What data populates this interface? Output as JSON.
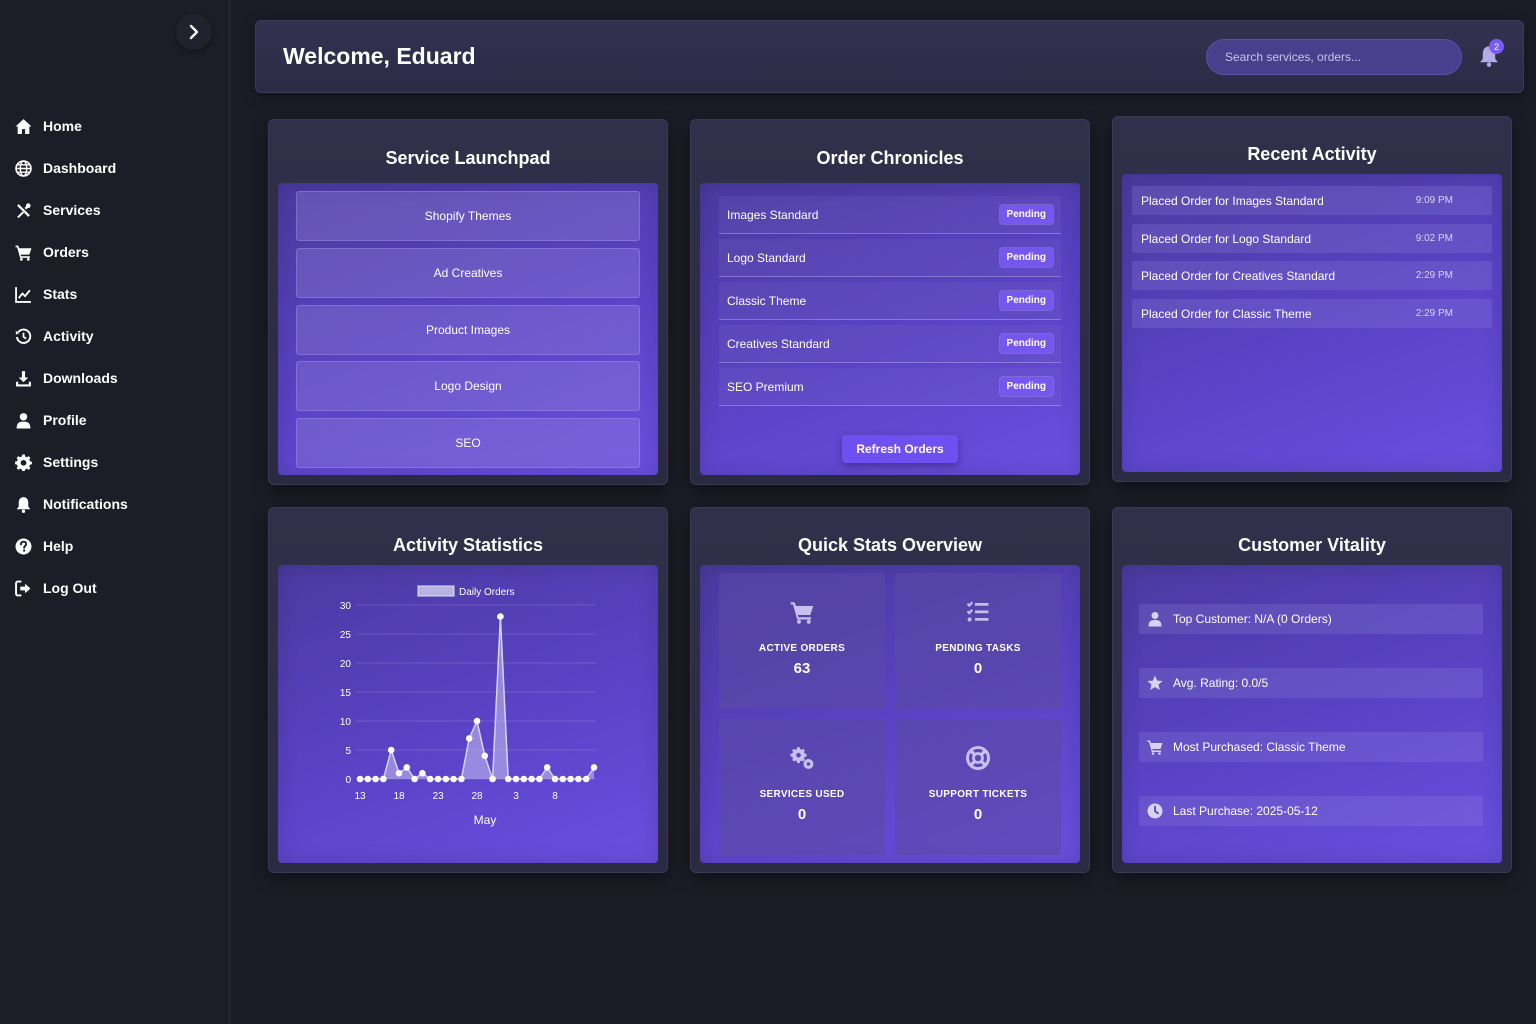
{
  "header": {
    "title": "Welcome, Eduard",
    "search_placeholder": "Search services, orders...",
    "notification_count": "2"
  },
  "sidebar": {
    "items": [
      {
        "label": "Home",
        "icon": "home-icon"
      },
      {
        "label": "Dashboard",
        "icon": "globe-icon"
      },
      {
        "label": "Services",
        "icon": "tools-icon"
      },
      {
        "label": "Orders",
        "icon": "cart-icon"
      },
      {
        "label": "Stats",
        "icon": "line-chart-icon"
      },
      {
        "label": "Activity",
        "icon": "history-icon"
      },
      {
        "label": "Downloads",
        "icon": "download-icon"
      },
      {
        "label": "Profile",
        "icon": "user-icon"
      },
      {
        "label": "Settings",
        "icon": "gear-icon"
      },
      {
        "label": "Notifications",
        "icon": "bell-icon"
      },
      {
        "label": "Help",
        "icon": "question-icon"
      },
      {
        "label": "Log Out",
        "icon": "logout-icon"
      }
    ]
  },
  "launchpad": {
    "title": "Service Launchpad",
    "buttons": [
      "Shopify Themes",
      "Ad Creatives",
      "Product Images",
      "Logo Design",
      "SEO"
    ]
  },
  "orders": {
    "title": "Order Chronicles",
    "rows": [
      {
        "name": "Images Standard",
        "status": "Pending"
      },
      {
        "name": "Logo Standard",
        "status": "Pending"
      },
      {
        "name": "Classic Theme",
        "status": "Pending"
      },
      {
        "name": "Creatives Standard",
        "status": "Pending"
      },
      {
        "name": "SEO Premium",
        "status": "Pending"
      }
    ],
    "refresh_label": "Refresh Orders"
  },
  "activity": {
    "title": "Recent Activity",
    "rows": [
      {
        "text": "Placed Order for Images Standard",
        "time": "9:09 PM"
      },
      {
        "text": "Placed Order for Logo Standard",
        "time": "9:02 PM"
      },
      {
        "text": "Placed Order for Creatives Standard",
        "time": "2:29 PM"
      },
      {
        "text": "Placed Order for Classic Theme",
        "time": "2:29 PM"
      }
    ]
  },
  "stats_card": {
    "title": "Activity Statistics"
  },
  "chart_data": {
    "type": "area",
    "title": "",
    "xlabel": "May",
    "ylabel": "",
    "ylim": [
      0,
      30
    ],
    "yticks": [
      "0",
      "5",
      "10",
      "15",
      "20",
      "25",
      "30"
    ],
    "xtick_labels": [
      {
        "index": 0,
        "label": "13"
      },
      {
        "index": 5,
        "label": "18"
      },
      {
        "index": 10,
        "label": "23"
      },
      {
        "index": 15,
        "label": "28"
      },
      {
        "index": 20,
        "label": "3"
      },
      {
        "index": 25,
        "label": "8"
      }
    ],
    "legend": "top",
    "grid": true,
    "series": [
      {
        "name": "Daily Orders",
        "values": [
          0,
          0,
          0,
          0,
          5,
          1,
          2,
          0,
          1,
          0,
          0,
          0,
          0,
          0,
          7,
          10,
          4,
          0,
          28,
          0,
          0,
          0,
          0,
          0,
          2,
          0,
          0,
          0,
          0,
          0,
          2
        ]
      }
    ]
  },
  "quick_stats": {
    "title": "Quick Stats Overview",
    "cells": [
      {
        "label": "ACTIVE ORDERS",
        "value": "63",
        "icon": "cart-icon"
      },
      {
        "label": "PENDING TASKS",
        "value": "0",
        "icon": "tasks-icon"
      },
      {
        "label": "SERVICES USED",
        "value": "0",
        "icon": "cogs-icon"
      },
      {
        "label": "SUPPORT TICKETS",
        "value": "0",
        "icon": "lifering-icon"
      }
    ]
  },
  "vitality": {
    "title": "Customer Vitality",
    "rows": [
      {
        "text": "Top Customer: N/A (0 Orders)",
        "icon": "user-icon"
      },
      {
        "text": "Avg. Rating: 0.0/5",
        "icon": "star-icon"
      },
      {
        "text": "Most Purchased: Classic Theme",
        "icon": "cart-icon"
      },
      {
        "text": "Last Purchase: 2025-05-12",
        "icon": "clock-icon"
      }
    ]
  },
  "colors": {
    "background": "#1c1c27",
    "accent": "#6e4ff0",
    "panel_gradient_start": "#4b3aa0",
    "panel_gradient_end": "#6a4fe0"
  }
}
